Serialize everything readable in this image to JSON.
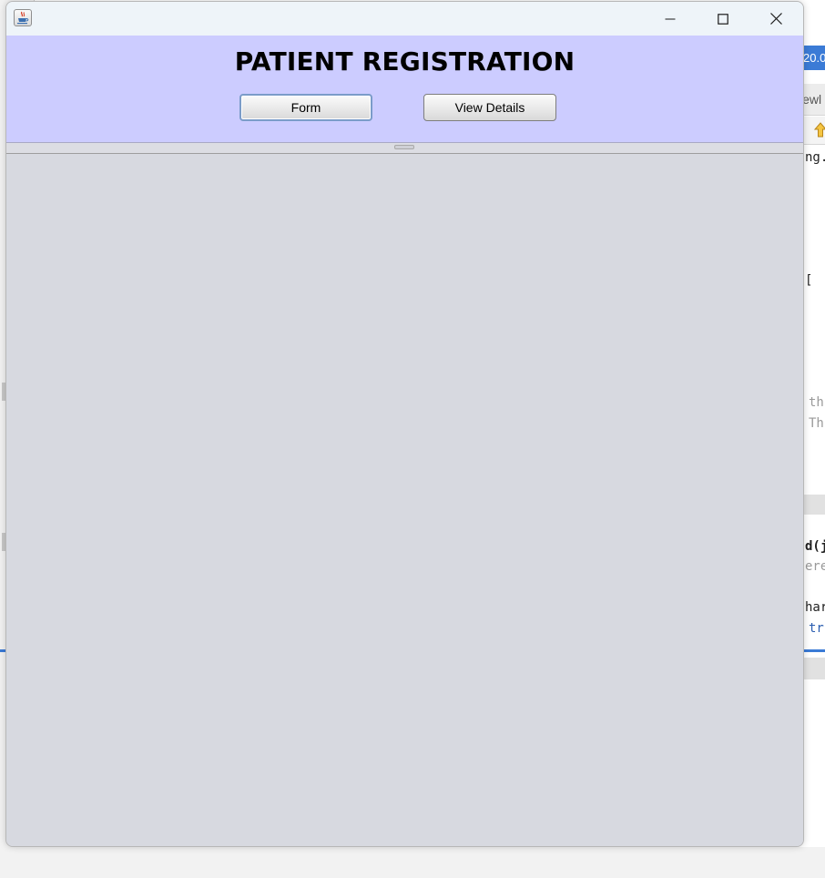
{
  "background": {
    "tab_fragment": "20.0",
    "toolbar_fragment": "iewl",
    "code_fragments": [
      {
        "text": "ng.",
        "style": "dark"
      },
      {
        "text": "[",
        "style": "dark"
      },
      {
        "text": "th",
        "style": "gray"
      },
      {
        "text": "Th",
        "style": "gray"
      },
      {
        "text": "d(j",
        "style": "bold"
      },
      {
        "text": "ere",
        "style": "gray"
      },
      {
        "text": "har",
        "style": "dark"
      },
      {
        "text": "tr",
        "style": "blue"
      }
    ]
  },
  "window": {
    "app_icon": "java-cup-icon",
    "controls": {
      "minimize_icon": "minimize-icon",
      "maximize_icon": "maximize-icon",
      "close_icon": "close-icon"
    }
  },
  "header": {
    "title": "PATIENT REGISTRATION",
    "background_color": "#ccccff",
    "buttons": {
      "form_label": "Form",
      "view_details_label": "View Details"
    }
  },
  "content": {
    "background_color": "#d7d9e0"
  }
}
